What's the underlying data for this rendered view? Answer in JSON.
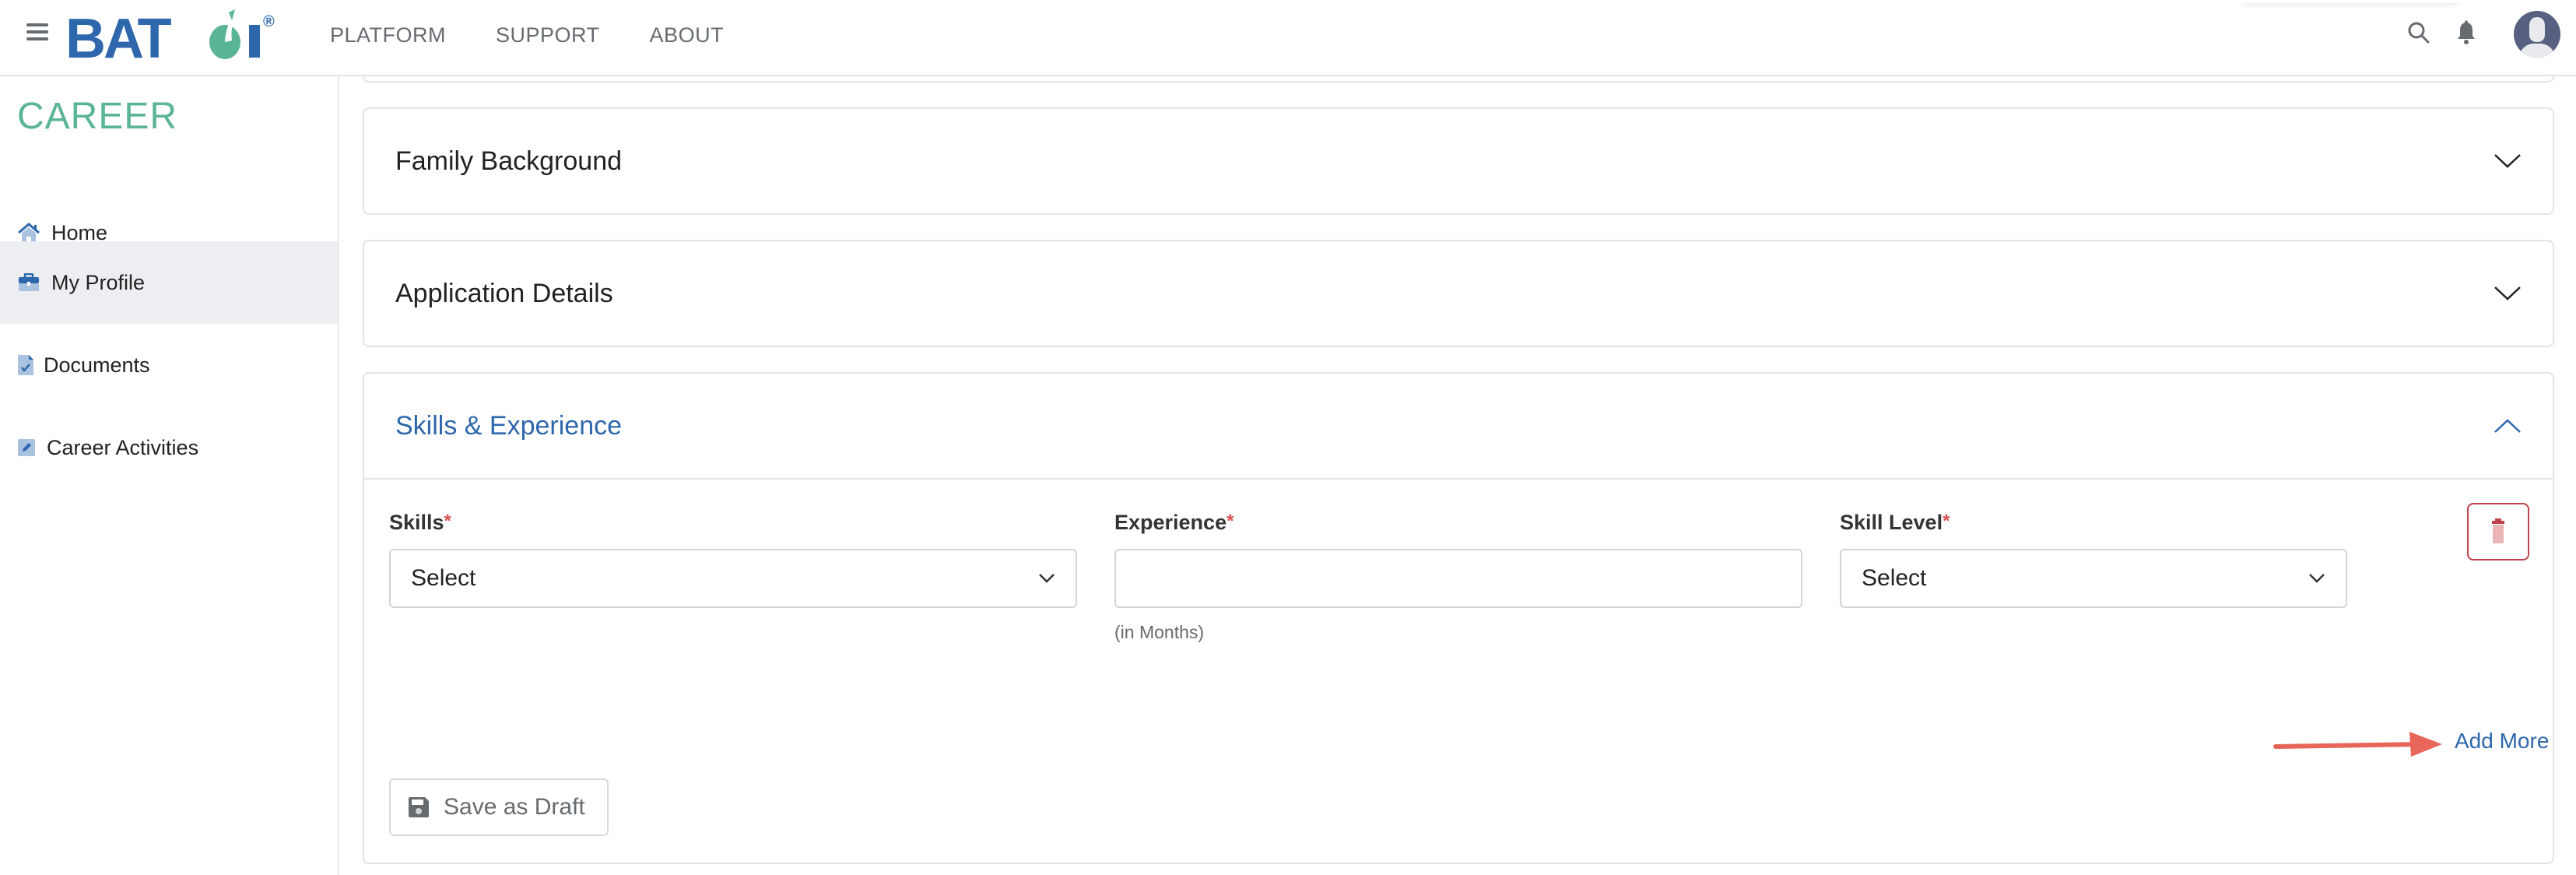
{
  "header": {
    "logo_text": "BATOI",
    "logo_reg": "®",
    "nav": [
      "PLATFORM",
      "SUPPORT",
      "ABOUT"
    ]
  },
  "sidebar": {
    "brand": "CAREER",
    "items": [
      {
        "label": "Home",
        "icon": "home-icon",
        "active": false
      },
      {
        "label": "My Profile",
        "icon": "briefcase-icon",
        "active": true
      },
      {
        "label": "Documents",
        "icon": "document-check-icon",
        "active": false
      },
      {
        "label": "Career Activities",
        "icon": "edit-icon",
        "active": false
      }
    ]
  },
  "sections": [
    {
      "title": "Family Background",
      "expanded": false
    },
    {
      "title": "Application Details",
      "expanded": false
    },
    {
      "title": "Skills & Experience",
      "expanded": true
    }
  ],
  "skills_form": {
    "skills": {
      "label": "Skills",
      "required": "*",
      "value": "Select"
    },
    "experience": {
      "label": "Experience",
      "required": "*",
      "value": "",
      "placeholder": "",
      "hint": "(in Months)"
    },
    "skill_level": {
      "label": "Skill Level",
      "required": "*",
      "value": "Select"
    },
    "add_more": "Add More",
    "save_draft": "Save as Draft"
  },
  "colors": {
    "brand_blue": "#2e67ac",
    "brand_green": "#5ab596",
    "danger": "#c0424a",
    "annotation_arrow": "#e8655a"
  }
}
